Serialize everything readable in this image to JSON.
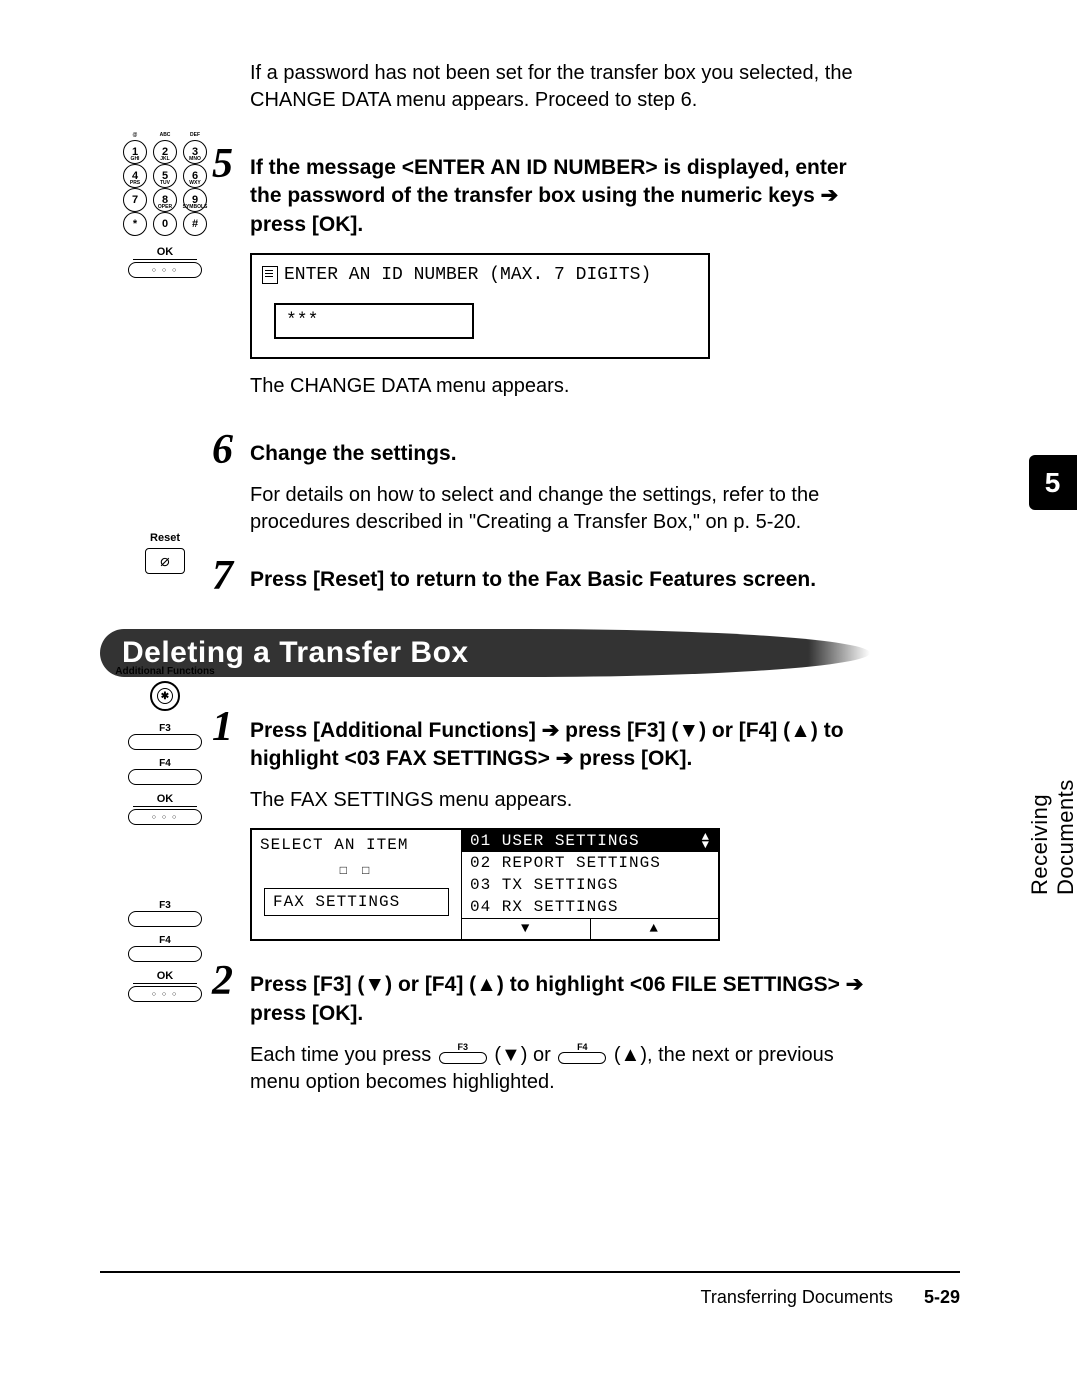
{
  "side_tab": {
    "number": "5",
    "label": "Receiving Documents"
  },
  "intro": "If a password has not been set for the transfer box you selected, the CHANGE DATA menu appears. Proceed to step 6.",
  "step5": {
    "num": "5",
    "head_before": "If the message <ENTER AN ID NUMBER> is displayed, enter the password of the transfer box using the numeric keys ",
    "head_after": " press [OK].",
    "lcd_line": "ENTER AN ID NUMBER (MAX. 7 DIGITS)",
    "lcd_value": "***",
    "after": "The CHANGE DATA menu appears."
  },
  "step6": {
    "num": "6",
    "head": "Change the settings.",
    "body": "For details on how to select and change the settings, refer to the procedures described in \"Creating a Transfer Box,\" on p. 5-20."
  },
  "step7": {
    "num": "7",
    "head": "Press [Reset] to return to the Fax Basic Features screen."
  },
  "section_title": "Deleting a Transfer Box",
  "d_step1": {
    "num": "1",
    "head_a": "Press [Additional Functions] ",
    "head_b": " press [F3] (▼) or [F4] (▲) to highlight <03 FAX SETTINGS> ",
    "head_c": " press [OK].",
    "after": "The FAX SETTINGS menu appears.",
    "menu_left_title": "SELECT AN ITEM",
    "menu_left_box": "FAX SETTINGS",
    "menu_items": [
      "01 USER SETTINGS",
      "02 REPORT SETTINGS",
      "03 TX SETTINGS",
      "04 RX SETTINGS"
    ]
  },
  "d_step2": {
    "num": "2",
    "head_a": "Press [F3] (▼) or [F4] (▲) to highlight <06 FILE SETTINGS> ",
    "head_b": " press [OK].",
    "body_a": "Each time you press ",
    "body_b": " (▼) or ",
    "body_c": " (▲), the next or previous menu option becomes highlighted."
  },
  "keypad": {
    "rows": [
      [
        {
          "n": "1",
          "s": "@"
        },
        {
          "n": "2",
          "s": "ABC"
        },
        {
          "n": "3",
          "s": "DEF"
        }
      ],
      [
        {
          "n": "4",
          "s": "GHI"
        },
        {
          "n": "5",
          "s": "JKL"
        },
        {
          "n": "6",
          "s": "MNO"
        }
      ],
      [
        {
          "n": "7",
          "s": "PRS"
        },
        {
          "n": "8",
          "s": "TUV"
        },
        {
          "n": "9",
          "s": "WXY"
        }
      ],
      [
        {
          "n": "*",
          "s": ""
        },
        {
          "n": "0",
          "s": "OPER"
        },
        {
          "n": "#",
          "s": "SYMBOLS"
        }
      ]
    ],
    "ok": "OK"
  },
  "reset_label": "Reset",
  "af_label": "Additional Functions",
  "fn": {
    "f3": "F3",
    "f4": "F4",
    "ok": "OK"
  },
  "arrow_right": "➔",
  "footer": {
    "title": "Transferring Documents",
    "page": "5-29"
  }
}
